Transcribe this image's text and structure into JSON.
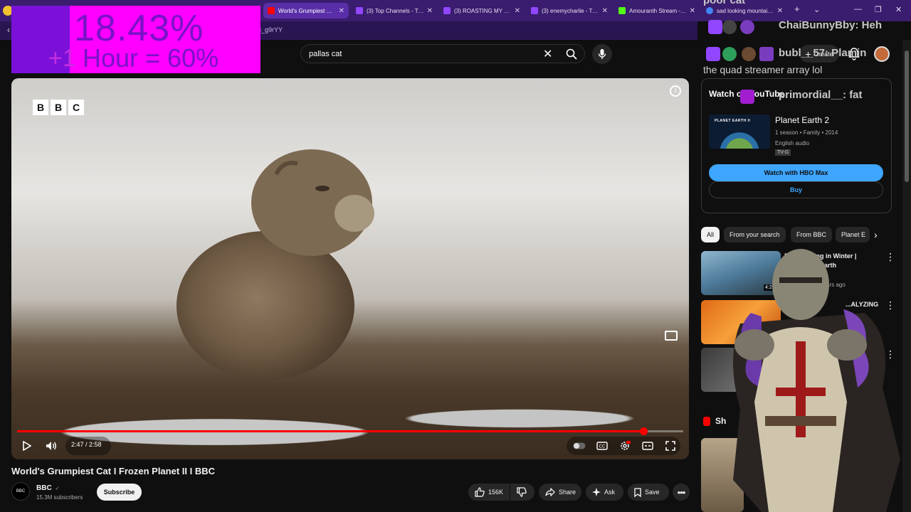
{
  "browser": {
    "tabs": [
      {
        "title": "World's Grumpiest Cat I",
        "favicon_color": "#ff0000",
        "active": true
      },
      {
        "title": "(3) Top Channels - Twitc",
        "favicon_color": "#9146ff",
        "active": false
      },
      {
        "title": "(3) ROASTING MY TIM F",
        "favicon_color": "#9146ff",
        "active": false
      },
      {
        "title": "(3) enemycharlie - Twitc",
        "favicon_color": "#9146ff",
        "active": false
      },
      {
        "title": "Amouranth Stream - W",
        "favicon_color": "#53fc18",
        "active": false
      },
      {
        "title": "sad looking mountain c",
        "favicon_color": "#4285f4",
        "active": false
      }
    ],
    "new_tab": "+",
    "url_fragment": "3_g9rYY"
  },
  "overlay": {
    "percent": "18.43%",
    "plus": "+1",
    "hour_text": "Hour = 60%"
  },
  "search": {
    "query": "pallas cat"
  },
  "header": {
    "create_label": "Create"
  },
  "video": {
    "brand": [
      "B",
      "B",
      "C"
    ],
    "time": "2:47 / 2:58",
    "progress_fraction": 0.94,
    "title": "World's Grumpiest Cat I Frozen Planet II I BBC"
  },
  "channel": {
    "avatar_text": "BBC",
    "name": "BBC",
    "verified": "✓",
    "subscribers": "15.3M subscribers",
    "subscribe_label": "Subscribe"
  },
  "actions": {
    "likes": "156K",
    "share": "Share",
    "ask": "Ask",
    "save": "Save"
  },
  "chat": {
    "line1": "poor cat",
    "line2_user": "ChaiBunnyBby: Heh",
    "line3_user": "bubl__57: Plamin",
    "line4_msg": "the quad streamer array lol",
    "line5_user": "primordial__: fat"
  },
  "watch_on_youtube": {
    "heading": "Watch on YouTube",
    "thumb_label": "PLANET EARTH II",
    "show_title": "Planet Earth 2",
    "meta": "1 season • Family • 2014",
    "audio": "English audio",
    "rating": "TV-G",
    "primary_button": "Watch with HBO Max",
    "secondary_button": "Buy"
  },
  "chips": [
    "All",
    "From your search",
    "From BBC",
    "Planet E"
  ],
  "recommendations": [
    {
      "title_line1": "Be... Hunting in Winter |",
      "title_line2": "...h II | BBC Earth",
      "meta": "...ears ago",
      "duration": "4:2"
    },
    {
      "title_line1": "...ALYZING",
      "title_line2": "",
      "meta": "",
      "duration": ""
    },
    {
      "title_line1": "",
      "title_line2": "",
      "meta": "",
      "duration": ""
    }
  ],
  "shorts_label": "Sh"
}
